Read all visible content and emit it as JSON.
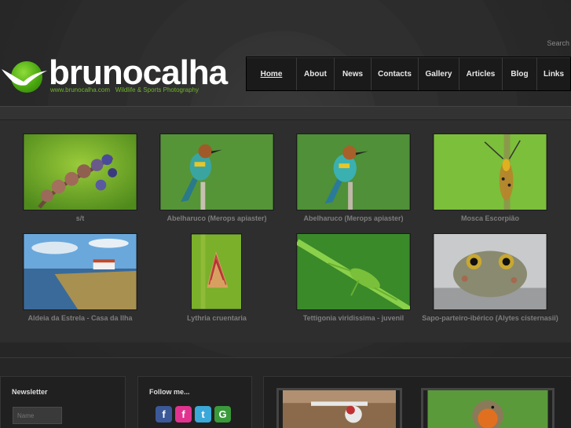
{
  "header": {
    "search_label": "Search",
    "logo_text": "brunocalha",
    "logo_url": "www.brunocalha.com",
    "logo_tagline": "Wildlife & Sports Photography"
  },
  "nav": {
    "items": [
      {
        "label": "Home",
        "active": true
      },
      {
        "label": "About"
      },
      {
        "label": "News"
      },
      {
        "label": "Contacts"
      },
      {
        "label": "Gallery"
      },
      {
        "label": "Articles"
      },
      {
        "label": "Blog"
      },
      {
        "label": "Links"
      }
    ]
  },
  "gallery": {
    "items": [
      {
        "caption": "s/t"
      },
      {
        "caption": "Abelharuco (Merops apiaster)"
      },
      {
        "caption": "Abelharuco (Merops apiaster)"
      },
      {
        "caption": "Mosca Escorpião"
      },
      {
        "caption": "Aldeia da Estrela - Casa da Ilha"
      },
      {
        "caption": "Lythria cruentaria"
      },
      {
        "caption": "Tettigonia viridissima - juvenil"
      },
      {
        "caption": "Sapo-parteiro-ibérico (Alytes cisternasii)"
      }
    ]
  },
  "footer": {
    "newsletter_title": "Newsletter",
    "name_placeholder": "Name",
    "follow_title": "Follow me...",
    "social": [
      {
        "icon": "facebook-icon",
        "glyph": "f",
        "color": "#3b5998"
      },
      {
        "icon": "flickr-icon",
        "glyph": "f",
        "color": "#e0338f"
      },
      {
        "icon": "twitter-icon",
        "glyph": "t",
        "color": "#3aa8d8"
      },
      {
        "icon": "google-icon",
        "glyph": "G",
        "color": "#3a9a3a"
      }
    ]
  },
  "colors": {
    "accent_green": "#6fb52c",
    "background": "#2b2b2b",
    "nav_bg": "#1a1a1a"
  }
}
